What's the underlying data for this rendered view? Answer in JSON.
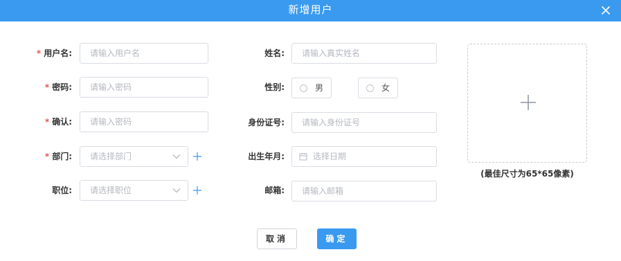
{
  "dialog": {
    "title": "新增用户",
    "close_icon": "close-icon"
  },
  "form": {
    "username": {
      "required": "*",
      "label": "用户名:",
      "placeholder": "请输入用户名"
    },
    "password": {
      "required": "*",
      "label": "密码:",
      "placeholder": "请输入密码"
    },
    "confirm": {
      "required": "*",
      "label": "确认:",
      "placeholder": "请输入密码"
    },
    "department": {
      "required": "*",
      "label": "部门:",
      "placeholder": "请选择部门",
      "add_icon": "plus-icon"
    },
    "position": {
      "label": "职位:",
      "placeholder": "请选择职位",
      "add_icon": "plus-icon"
    },
    "realname": {
      "label": "姓名:",
      "placeholder": "请输入真实姓名"
    },
    "gender": {
      "label": "性别:",
      "options": [
        "男",
        "女"
      ]
    },
    "idcard": {
      "label": "身份证号:",
      "placeholder": "请输入身份证号"
    },
    "birth": {
      "label": "出生年月:",
      "placeholder": "选择日期",
      "icon": "calendar-icon"
    },
    "email": {
      "label": "邮箱:",
      "placeholder": "请输入邮箱"
    }
  },
  "avatar_upload": {
    "icon": "plus-icon",
    "hint": "(最佳尺寸为65*65像素)"
  },
  "buttons": {
    "cancel": "取消",
    "confirm": "确定"
  },
  "colors": {
    "primary": "#3a9af0",
    "required": "#f05050",
    "border": "#d8dce3",
    "placeholder": "#b4b8bf"
  }
}
